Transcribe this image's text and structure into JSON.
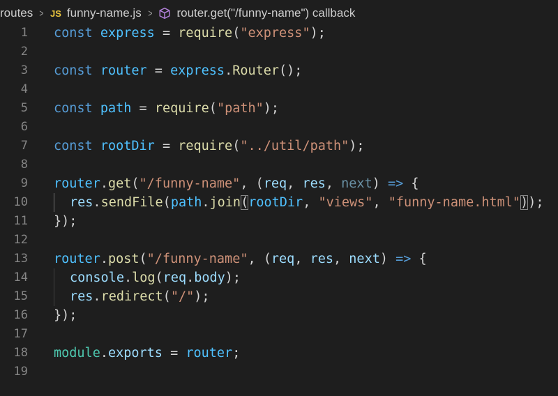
{
  "breadcrumb": {
    "folder": "routes",
    "file_badge": "JS",
    "file": "funny-name.js",
    "symbol": "router.get(\"/funny-name\") callback"
  },
  "colors": {
    "background": "#1e1e1e",
    "keyword": "#569cd6",
    "constant": "#4fc1ff",
    "function": "#dcdcaa",
    "string": "#ce9178",
    "variable": "#9cdcfe",
    "text": "#d4d4d4",
    "line_number": "#858585"
  },
  "icons": {
    "separator": "chevron-right-icon",
    "file": "javascript-file-icon",
    "symbol": "method-cube-icon"
  },
  "lines": [
    {
      "n": "1",
      "tokens": [
        [
          "kw",
          "const"
        ],
        [
          "plain",
          " "
        ],
        [
          "var",
          "express"
        ],
        [
          "plain",
          " = "
        ],
        [
          "fn",
          "require"
        ],
        [
          "plain",
          "("
        ],
        [
          "str",
          "\"express\""
        ],
        [
          "plain",
          ");"
        ]
      ]
    },
    {
      "n": "2",
      "tokens": []
    },
    {
      "n": "3",
      "tokens": [
        [
          "kw",
          "const"
        ],
        [
          "plain",
          " "
        ],
        [
          "var",
          "router"
        ],
        [
          "plain",
          " = "
        ],
        [
          "var",
          "express"
        ],
        [
          "plain",
          "."
        ],
        [
          "fn",
          "Router"
        ],
        [
          "plain",
          "();"
        ]
      ]
    },
    {
      "n": "4",
      "tokens": []
    },
    {
      "n": "5",
      "tokens": [
        [
          "kw",
          "const"
        ],
        [
          "plain",
          " "
        ],
        [
          "var",
          "path"
        ],
        [
          "plain",
          " = "
        ],
        [
          "fn",
          "require"
        ],
        [
          "plain",
          "("
        ],
        [
          "str",
          "\"path\""
        ],
        [
          "plain",
          ");"
        ]
      ]
    },
    {
      "n": "6",
      "tokens": []
    },
    {
      "n": "7",
      "tokens": [
        [
          "kw",
          "const"
        ],
        [
          "plain",
          " "
        ],
        [
          "var",
          "rootDir"
        ],
        [
          "plain",
          " = "
        ],
        [
          "fn",
          "require"
        ],
        [
          "plain",
          "("
        ],
        [
          "str",
          "\"../util/path\""
        ],
        [
          "plain",
          ");"
        ]
      ]
    },
    {
      "n": "8",
      "tokens": []
    },
    {
      "n": "9",
      "tokens": [
        [
          "var",
          "router"
        ],
        [
          "plain",
          "."
        ],
        [
          "fn",
          "get"
        ],
        [
          "plain",
          "("
        ],
        [
          "str",
          "\"/funny-name\""
        ],
        [
          "plain",
          ", ("
        ],
        [
          "param",
          "req"
        ],
        [
          "plain",
          ", "
        ],
        [
          "param",
          "res"
        ],
        [
          "plain",
          ", "
        ],
        [
          "unused",
          "next"
        ],
        [
          "plain",
          ") "
        ],
        [
          "kw",
          "=>"
        ],
        [
          "plain",
          " {"
        ]
      ]
    },
    {
      "n": "10",
      "indent": 1,
      "active": true,
      "tokens": [
        [
          "prop",
          "res"
        ],
        [
          "plain",
          "."
        ],
        [
          "fn",
          "sendFile"
        ],
        [
          "plain",
          "("
        ],
        [
          "var",
          "path"
        ],
        [
          "plain",
          "."
        ],
        [
          "fn",
          "join"
        ],
        [
          "bracket",
          "("
        ],
        [
          "var",
          "rootDir"
        ],
        [
          "plain",
          ", "
        ],
        [
          "str",
          "\"views\""
        ],
        [
          "plain",
          ", "
        ],
        [
          "str",
          "\"funny-name.html\""
        ],
        [
          "bracket",
          ")"
        ],
        [
          "plain",
          ");"
        ]
      ]
    },
    {
      "n": "11",
      "tokens": [
        [
          "plain",
          "});"
        ]
      ]
    },
    {
      "n": "12",
      "tokens": []
    },
    {
      "n": "13",
      "tokens": [
        [
          "var",
          "router"
        ],
        [
          "plain",
          "."
        ],
        [
          "fn",
          "post"
        ],
        [
          "plain",
          "("
        ],
        [
          "str",
          "\"/funny-name\""
        ],
        [
          "plain",
          ", ("
        ],
        [
          "param",
          "req"
        ],
        [
          "plain",
          ", "
        ],
        [
          "param",
          "res"
        ],
        [
          "plain",
          ", "
        ],
        [
          "param",
          "next"
        ],
        [
          "plain",
          ") "
        ],
        [
          "kw",
          "=>"
        ],
        [
          "plain",
          " {"
        ]
      ]
    },
    {
      "n": "14",
      "indent": 1,
      "tokens": [
        [
          "mod",
          "console"
        ],
        [
          "plain",
          "."
        ],
        [
          "fn",
          "log"
        ],
        [
          "plain",
          "("
        ],
        [
          "param",
          "req"
        ],
        [
          "plain",
          "."
        ],
        [
          "prop",
          "body"
        ],
        [
          "plain",
          ");"
        ]
      ]
    },
    {
      "n": "15",
      "indent": 1,
      "tokens": [
        [
          "param",
          "res"
        ],
        [
          "plain",
          "."
        ],
        [
          "fn",
          "redirect"
        ],
        [
          "plain",
          "("
        ],
        [
          "str",
          "\"/\""
        ],
        [
          "plain",
          ");"
        ]
      ]
    },
    {
      "n": "16",
      "tokens": [
        [
          "plain",
          "});"
        ]
      ]
    },
    {
      "n": "17",
      "tokens": []
    },
    {
      "n": "18",
      "tokens": [
        [
          "type",
          "module"
        ],
        [
          "plain",
          "."
        ],
        [
          "prop",
          "exports"
        ],
        [
          "plain",
          " = "
        ],
        [
          "var",
          "router"
        ],
        [
          "plain",
          ";"
        ]
      ]
    },
    {
      "n": "19",
      "tokens": []
    }
  ]
}
